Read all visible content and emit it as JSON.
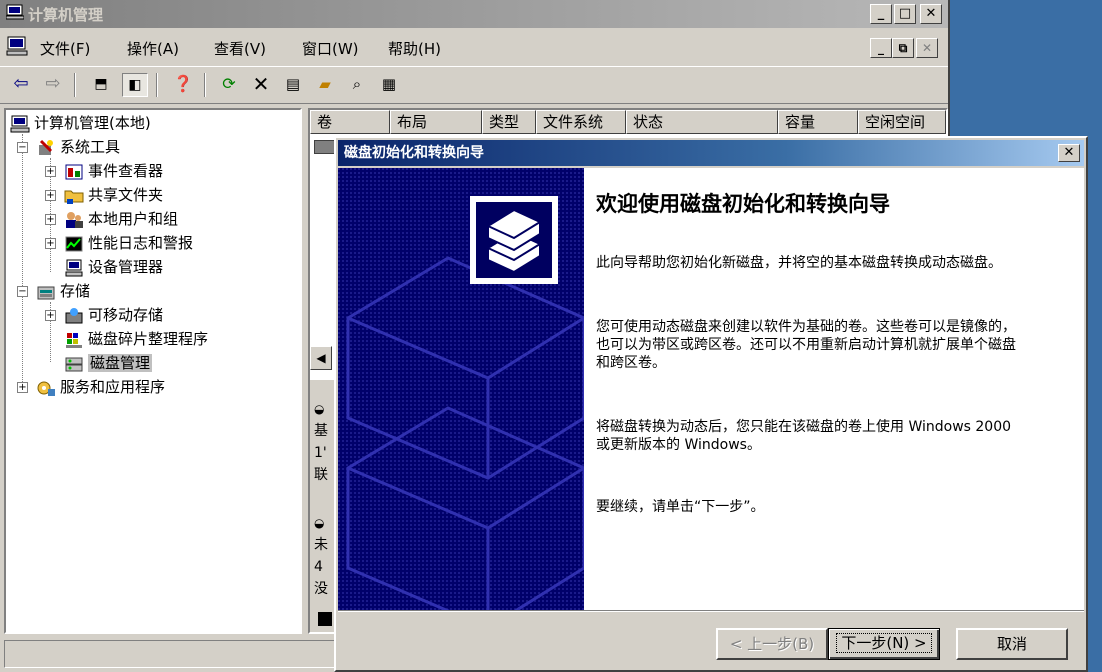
{
  "window": {
    "title": "计算机管理"
  },
  "menu": [
    "文件(F)",
    "操作(A)",
    "查看(V)",
    "窗口(W)",
    "帮助(H)"
  ],
  "tree": {
    "root": "计算机管理(本地)",
    "system_tools": "系统工具",
    "event_viewer": "事件查看器",
    "shared_folders": "共享文件夹",
    "local_users": "本地用户和组",
    "perf_logs": "性能日志和警报",
    "device_manager": "设备管理器",
    "storage": "存储",
    "removable_storage": "可移动存储",
    "defrag": "磁盘碎片整理程序",
    "disk_mgmt": "磁盘管理",
    "services": "服务和应用程序"
  },
  "columns": [
    "卷",
    "布局",
    "类型",
    "文件系统",
    "状态",
    "容量",
    "空闲空间"
  ],
  "lower_pane": {
    "disk0": [
      "基",
      "1'",
      "联"
    ],
    "disk1": [
      "未",
      "4",
      "没"
    ]
  },
  "wizard": {
    "title": "磁盘初始化和转换向导",
    "heading": "欢迎使用磁盘初始化和转换向导",
    "p1": "此向导帮助您初始化新磁盘，并将空的基本磁盘转换成动态磁盘。",
    "p2": "您可使用动态磁盘来创建以软件为基础的卷。这些卷可以是镜像的，也可以为带区或跨区卷。还可以不用重新启动计算机就扩展单个磁盘和跨区卷。",
    "p3": "将磁盘转换为动态后，您只能在该磁盘的卷上使用 Windows 2000 或更新版本的 Windows。",
    "p4": "要继续，请单击“下一步”。",
    "back": "< 上一步(B)",
    "next": "下一步(N) >",
    "cancel": "取消"
  },
  "colors": {
    "title_inactive": "#808080",
    "wizard_title": "#0a246a",
    "wizard_panel": "#000060",
    "desktop": "#3a6ea5"
  }
}
